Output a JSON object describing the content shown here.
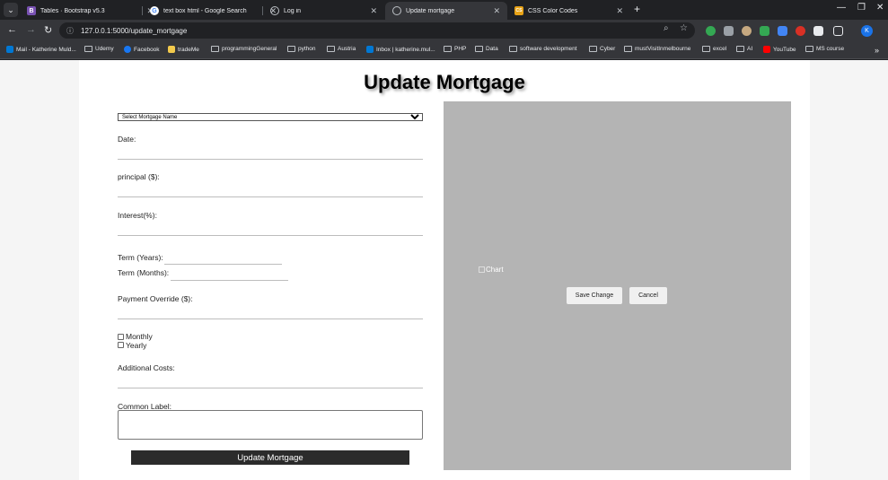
{
  "browser": {
    "tabs": [
      {
        "title": "Tables · Bootstrap v5.3",
        "fav": "B",
        "fav_color": "#7952b3"
      },
      {
        "title": "text box html - Google Search",
        "fav": "G",
        "fav_color": "#4285f4"
      },
      {
        "title": "Log in",
        "fav": "",
        "fav_color": "#5f6368"
      },
      {
        "title": "Update mortgage",
        "fav": "",
        "fav_color": "#5f6368"
      },
      {
        "title": "CSS Color Codes",
        "fav": "CS",
        "fav_color": "#e8a317"
      }
    ],
    "url": "127.0.0.1:5000/update_mortgage",
    "profile_initial": "K",
    "bookmarks": [
      "Mail - Katherine Muld...",
      "Udemy",
      "Facebook",
      "tradeMe",
      "programmingGeneral",
      "python",
      "Austria",
      "Inbox | katherine.mul...",
      "PHP",
      "Data",
      "software development",
      "Cyber",
      "mustVisitInmelbourne",
      "excel",
      "AI",
      "YouTube",
      "MS course"
    ]
  },
  "page": {
    "title": "Update Mortgage",
    "mortgage_select": {
      "selected": "Select Mortgage Name"
    },
    "labels": {
      "date": "Date:",
      "principal": "principal ($):",
      "interest": "Interest(%):",
      "term_years": "Term (Years):",
      "term_months": "Term (Months):",
      "payment_override": "Payment Override ($):",
      "monthly": "Monthly",
      "yearly": "Yearly",
      "additional_costs": "Additional Costs:",
      "common_label": "Common Label:"
    },
    "update_button": "Update Mortgage",
    "chart_alt": "Chart",
    "save_button": "Save Change",
    "cancel_button": "Cancel"
  },
  "colors": {
    "chart_panel": "#b4b4b4",
    "update_button": "#2b2b2b",
    "browser_chrome": "#202124"
  }
}
